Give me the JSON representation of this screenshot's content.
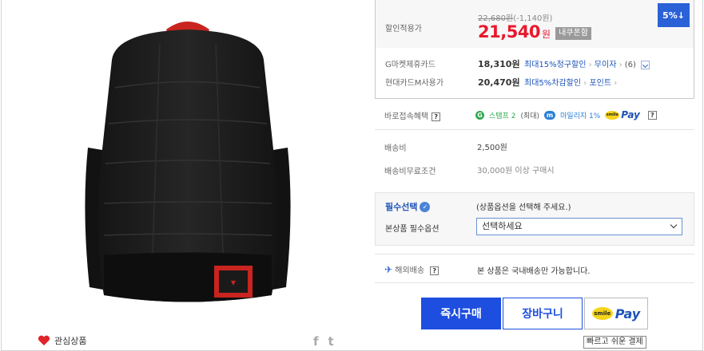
{
  "price": {
    "label": "할인적용가",
    "original": "22,680원",
    "discount_amount": "(-1,140원)",
    "sale_value": "21,540",
    "sale_unit": "원",
    "coupon_badge": "내쿠폰함",
    "discount_percent": "5%↓"
  },
  "cards": [
    {
      "label": "G마켓제휴카드",
      "price": "18,310원",
      "benefit": "최대15%청구할인",
      "extra": "무이자",
      "extra_count": "(6)"
    },
    {
      "label": "현대카드M사용가",
      "price": "20,470원",
      "benefit": "최대5%차감할인",
      "extra": "포인트"
    }
  ],
  "quick_benefit": {
    "label": "바로접속혜택",
    "stamp_icon": "G",
    "stamp_text": "스탬프 2",
    "stamp_note": "(최대)",
    "mileage_icon": "m",
    "mileage_text": "마일리지 1%",
    "smile": "smile",
    "pay": "Pay"
  },
  "shipping": {
    "fee_label": "배송비",
    "fee_value": "2,500원",
    "free_label": "배송비무료조건",
    "free_value": "30,000원 이상 구매시"
  },
  "options": {
    "title": "필수선택",
    "hint": "(상품옵션을 선택해 주세요.)",
    "label": "본상품 필수옵션",
    "selected": "선택하세요"
  },
  "overseas": {
    "label": "해외배송",
    "note": "본 상품은 국내배송만 가능합니다."
  },
  "actions": {
    "buy": "즉시구매",
    "cart": "장바구니",
    "smile": "smile",
    "pay": "Pay",
    "tooltip": "빠르고 쉬운 결제"
  },
  "left": {
    "wish_label": "관심상품",
    "share_facebook": "f",
    "share_twitter": "t"
  },
  "colors": {
    "accent_blue": "#1d4ee0",
    "sale_red": "#e8192c",
    "badge_blue": "#2b61d6"
  }
}
